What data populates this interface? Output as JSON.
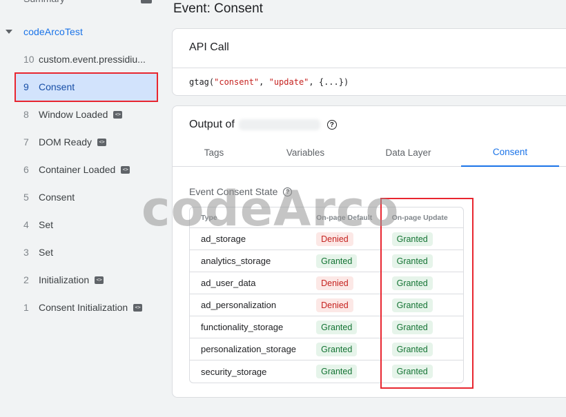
{
  "sidebar": {
    "summary_label": "Summary",
    "container_name": "codeArcoTest",
    "events": [
      {
        "num": "10",
        "label": "custom.event.pressidiu...",
        "badge": false,
        "active": false
      },
      {
        "num": "9",
        "label": "Consent",
        "badge": false,
        "active": true
      },
      {
        "num": "8",
        "label": "Window Loaded",
        "badge": true,
        "active": false
      },
      {
        "num": "7",
        "label": "DOM Ready",
        "badge": true,
        "active": false
      },
      {
        "num": "6",
        "label": "Container Loaded",
        "badge": true,
        "active": false
      },
      {
        "num": "5",
        "label": "Consent",
        "badge": false,
        "active": false
      },
      {
        "num": "4",
        "label": "Set",
        "badge": false,
        "active": false
      },
      {
        "num": "3",
        "label": "Set",
        "badge": false,
        "active": false
      },
      {
        "num": "2",
        "label": "Initialization",
        "badge": true,
        "active": false
      },
      {
        "num": "1",
        "label": "Consent Initialization",
        "badge": true,
        "active": false
      }
    ]
  },
  "main": {
    "title": "Event: Consent",
    "api_card": {
      "title": "API Call",
      "code_prefix": "gtag(",
      "code_arg1": "\"consent\"",
      "code_sep": ", ",
      "code_arg2": "\"update\"",
      "code_suffix": ", {...})"
    },
    "output_card": {
      "title": "Output of",
      "tabs": [
        "Tags",
        "Variables",
        "Data Layer",
        "Consent"
      ],
      "active_tab": "Consent",
      "section_label": "Event Consent State",
      "table": {
        "headers": [
          "Type",
          "On-page Default",
          "On-page Update"
        ],
        "rows": [
          {
            "type": "ad_storage",
            "default": "Denied",
            "update": "Granted"
          },
          {
            "type": "analytics_storage",
            "default": "Granted",
            "update": "Granted"
          },
          {
            "type": "ad_user_data",
            "default": "Denied",
            "update": "Granted"
          },
          {
            "type": "ad_personalization",
            "default": "Denied",
            "update": "Granted"
          },
          {
            "type": "functionality_storage",
            "default": "Granted",
            "update": "Granted"
          },
          {
            "type": "personalization_storage",
            "default": "Granted",
            "update": "Granted"
          },
          {
            "type": "security_storage",
            "default": "Granted",
            "update": "Granted"
          }
        ]
      }
    }
  },
  "watermark": "codeArco",
  "colors": {
    "accent": "#1a73e8",
    "active_bg": "#d2e3fc",
    "granted_bg": "#e6f4ea",
    "granted_text": "#137333",
    "denied_bg": "#fce8e6",
    "denied_text": "#c5221f",
    "highlight": "#e8252f"
  }
}
